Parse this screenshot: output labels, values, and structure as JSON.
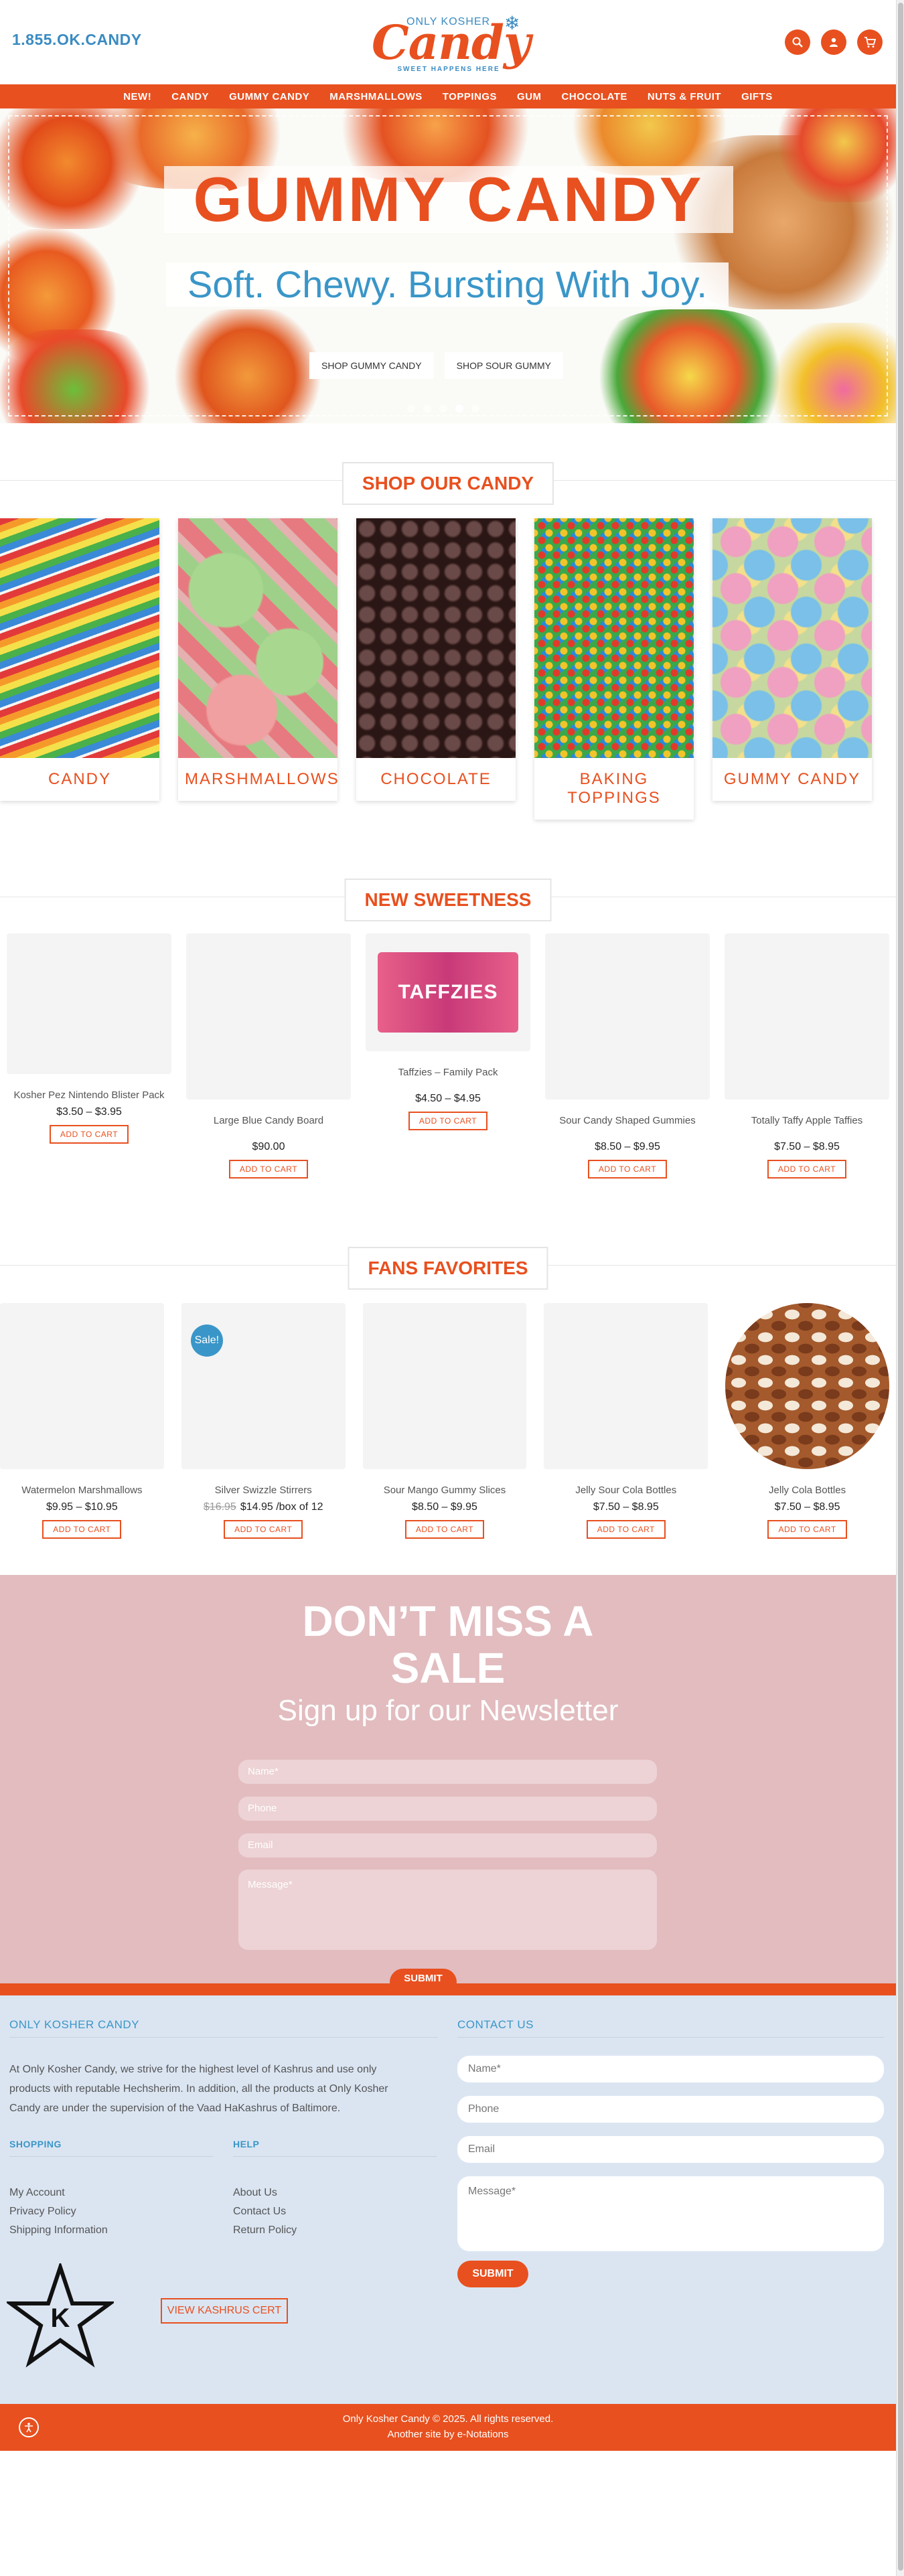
{
  "header": {
    "phone": "1.855.OK.CANDY",
    "logo_small": "ONLY KOSHER",
    "logo_big": "Candy",
    "logo_tagline": "SWEET HAPPENS HERE",
    "icons": [
      "search-icon",
      "user-icon",
      "cart-icon"
    ]
  },
  "nav": {
    "items": [
      "NEW!",
      "CANDY",
      "GUMMY CANDY",
      "MARSHMALLOWS",
      "TOPPINGS",
      "GUM",
      "CHOCOLATE",
      "NUTS & FRUIT",
      "GIFTS"
    ]
  },
  "hero": {
    "title": "GUMMY CANDY",
    "subtitle": "Soft. Chewy. Bursting With Joy.",
    "buttons": [
      "SHOP GUMMY CANDY",
      "SHOP SOUR GUMMY"
    ],
    "slides": 5,
    "active_slide": 4
  },
  "categories": {
    "heading": "SHOP OUR CANDY",
    "items": [
      "CANDY",
      "MARSHMALLOWS",
      "CHOCOLATE",
      "BAKING TOPPINGS",
      "GUMMY CANDY"
    ]
  },
  "new_sweetness": {
    "heading": "NEW SWEETNESS",
    "products": [
      {
        "name": "Kosher Pez Nintendo Blister Pack",
        "price": "$3.50 – $3.95",
        "button": "ADD TO CART"
      },
      {
        "name": "Large Blue Candy Board",
        "price": "$90.00",
        "button": "ADD TO CART"
      },
      {
        "name": "Taffzies – Family Pack",
        "price": "$4.50 – $4.95",
        "button": "ADD TO CART",
        "image_text": "TAFFZIES"
      },
      {
        "name": "Sour Candy Shaped Gummies",
        "price": "$8.50 – $9.95",
        "button": "ADD TO CART"
      },
      {
        "name": "Totally Taffy Apple Taffies",
        "price": "$7.50 – $8.95",
        "button": "ADD TO CART"
      }
    ]
  },
  "fans_favorites": {
    "heading": "FANS FAVORITES",
    "sale_badge": "Sale!",
    "products": [
      {
        "name": "Watermelon Marshmallows",
        "price": "$9.95 – $10.95",
        "button": "ADD TO CART"
      },
      {
        "name": "Silver Swizzle Stirrers",
        "old_price": "$16.95",
        "price": "$14.95 /box of 12",
        "button": "ADD TO CART"
      },
      {
        "name": "Sour Mango Gummy Slices",
        "price": "$8.50 – $9.95",
        "button": "ADD TO CART"
      },
      {
        "name": "Jelly Sour Cola Bottles",
        "price": "$7.50 – $8.95",
        "button": "ADD TO CART"
      },
      {
        "name": "Jelly Cola Bottles",
        "price": "$7.50 – $8.95",
        "button": "ADD TO CART"
      }
    ]
  },
  "newsletter": {
    "title_line1": "DON’T MISS A",
    "title_line2": "SALE",
    "subtitle": "Sign up for our Newsletter",
    "fields": [
      "Name*",
      "Phone",
      "Email",
      "Message*"
    ],
    "submit": "SUBMIT"
  },
  "footer": {
    "about_heading": "ONLY KOSHER CANDY",
    "about_text_1": "At Only Kosher Candy, we strive for the highest level of Kashrus and use only",
    "about_text_2": "products with reputable Hechsherim. In addition, all the products at Only Kosher",
    "about_text_3": "Candy are under the supervision of the Vaad HaKashrus of Baltimore.",
    "shopping_heading": "SHOPPING",
    "shopping_links": [
      "My Account",
      "Privacy Policy",
      "Shipping Information"
    ],
    "help_heading": "HELP",
    "help_links": [
      "About Us",
      "Contact Us",
      "Return Policy"
    ],
    "contact_heading": "CONTACT US",
    "contact_fields": [
      "Name*",
      "Phone",
      "Email",
      "Message*"
    ],
    "contact_submit": "SUBMIT",
    "kashrus_button": "VIEW KASHRUS CERT",
    "kashrus_letter": "K",
    "copyright": "Only Kosher Candy © 2025. All rights reserved.",
    "credit": "Another site by e-Notations"
  },
  "colors": {
    "brand_orange": "#e8501f",
    "brand_blue": "#3a96c8",
    "newsletter_pink": "#e2bcbf",
    "footer_blue": "#dbe5f2"
  }
}
